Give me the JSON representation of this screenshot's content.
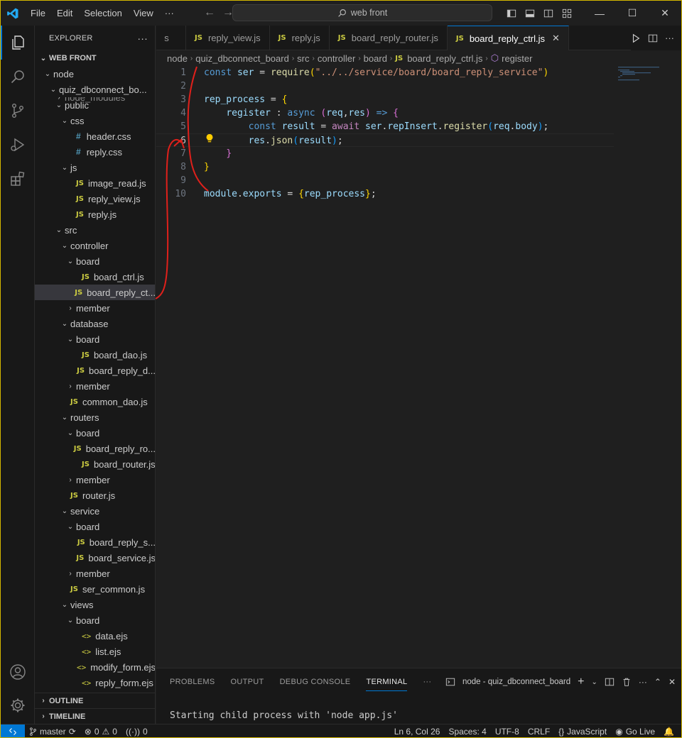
{
  "titlebar": {
    "menu": [
      "File",
      "Edit",
      "Selection",
      "View",
      "···"
    ],
    "search_text": "web front"
  },
  "sidebar": {
    "title": "EXPLORER",
    "more": "···",
    "root_label": "WEB FRONT",
    "tree": [
      {
        "label": "node",
        "chev": "⌄",
        "type": "folder"
      },
      {
        "label": "quiz_dbconnect_bo...",
        "chev": "⌄",
        "type": "folder"
      },
      {
        "label": "node_modules",
        "chev": "›",
        "type": "folder"
      },
      {
        "label": "public",
        "chev": "⌄",
        "type": "folder"
      },
      {
        "label": "css",
        "chev": "⌄",
        "type": "folder"
      },
      {
        "label": "header.css",
        "type": "css"
      },
      {
        "label": "reply.css",
        "type": "css"
      },
      {
        "label": "js",
        "chev": "⌄",
        "type": "folder"
      },
      {
        "label": "image_read.js",
        "type": "js"
      },
      {
        "label": "reply_view.js",
        "type": "js"
      },
      {
        "label": "reply.js",
        "type": "js"
      },
      {
        "label": "src",
        "chev": "⌄",
        "type": "folder"
      },
      {
        "label": "controller",
        "chev": "⌄",
        "type": "folder"
      },
      {
        "label": "board",
        "chev": "⌄",
        "type": "folder"
      },
      {
        "label": "board_ctrl.js",
        "type": "js"
      },
      {
        "label": "board_reply_ct...",
        "type": "js"
      },
      {
        "label": "member",
        "chev": "›",
        "type": "folder"
      },
      {
        "label": "database",
        "chev": "⌄",
        "type": "folder"
      },
      {
        "label": "board",
        "chev": "⌄",
        "type": "folder"
      },
      {
        "label": "board_dao.js",
        "type": "js"
      },
      {
        "label": "board_reply_d...",
        "type": "js"
      },
      {
        "label": "member",
        "chev": "›",
        "type": "folder"
      },
      {
        "label": "common_dao.js",
        "type": "js"
      },
      {
        "label": "routers",
        "chev": "⌄",
        "type": "folder"
      },
      {
        "label": "board",
        "chev": "⌄",
        "type": "folder"
      },
      {
        "label": "board_reply_ro...",
        "type": "js"
      },
      {
        "label": "board_router.js",
        "type": "js"
      },
      {
        "label": "member",
        "chev": "›",
        "type": "folder"
      },
      {
        "label": "router.js",
        "type": "js"
      },
      {
        "label": "service",
        "chev": "⌄",
        "type": "folder"
      },
      {
        "label": "board",
        "chev": "⌄",
        "type": "folder"
      },
      {
        "label": "board_reply_s...",
        "type": "js"
      },
      {
        "label": "board_service.js",
        "type": "js"
      },
      {
        "label": "member",
        "chev": "›",
        "type": "folder"
      },
      {
        "label": "ser_common.js",
        "type": "js"
      },
      {
        "label": "views",
        "chev": "⌄",
        "type": "folder"
      },
      {
        "label": "board",
        "chev": "⌄",
        "type": "folder"
      },
      {
        "label": "data.ejs",
        "type": "ejs"
      },
      {
        "label": "list.ejs",
        "type": "ejs"
      },
      {
        "label": "modify_form.ejs",
        "type": "ejs"
      },
      {
        "label": "reply_form.ejs",
        "type": "ejs"
      }
    ],
    "outline": "OUTLINE",
    "timeline": "TIMELINE",
    "js_badge": "JS",
    "css_badge": "#",
    "ejs_badge": "<>"
  },
  "tabs": [
    {
      "label": "s",
      "badge": ""
    },
    {
      "label": "reply_view.js",
      "badge": "JS"
    },
    {
      "label": "reply.js",
      "badge": "JS"
    },
    {
      "label": "board_reply_router.js",
      "badge": "JS"
    },
    {
      "label": "board_reply_ctrl.js",
      "badge": "JS",
      "active": true
    }
  ],
  "breadcrumb": [
    "node",
    "quiz_dbconnect_board",
    "src",
    "controller",
    "board",
    "board_reply_ctrl.js",
    "register"
  ],
  "editor": {
    "current_line": 6,
    "lines": [
      [
        [
          "kw",
          "const "
        ],
        [
          "var",
          "ser"
        ],
        [
          "pl",
          " = "
        ],
        [
          "fn",
          "require"
        ],
        [
          "br1",
          "("
        ],
        [
          "str",
          "\"../../service/board/board_reply_service\""
        ],
        [
          "br1",
          ")"
        ]
      ],
      [],
      [
        [
          "var",
          "rep_process"
        ],
        [
          "pl",
          " = "
        ],
        [
          "br1",
          "{"
        ]
      ],
      [
        [
          "pl",
          "    "
        ],
        [
          "var",
          "register"
        ],
        [
          "pl",
          " : "
        ],
        [
          "kw",
          "async "
        ],
        [
          "br2",
          "("
        ],
        [
          "var",
          "req"
        ],
        [
          "pl",
          ","
        ],
        [
          "var",
          "res"
        ],
        [
          "br2",
          ")"
        ],
        [
          "pl",
          " "
        ],
        [
          "kw",
          "=>"
        ],
        [
          "pl",
          " "
        ],
        [
          "br2",
          "{"
        ]
      ],
      [
        [
          "pl",
          "        "
        ],
        [
          "kw",
          "const "
        ],
        [
          "var",
          "result"
        ],
        [
          "pl",
          " = "
        ],
        [
          "ctl",
          "await "
        ],
        [
          "var",
          "ser"
        ],
        [
          "pl",
          "."
        ],
        [
          "var",
          "repInsert"
        ],
        [
          "pl",
          "."
        ],
        [
          "fn",
          "register"
        ],
        [
          "br3",
          "("
        ],
        [
          "var",
          "req"
        ],
        [
          "pl",
          "."
        ],
        [
          "var",
          "body"
        ],
        [
          "br3",
          ")"
        ],
        [
          "pl",
          ";"
        ]
      ],
      [
        [
          "pl",
          "        "
        ],
        [
          "var",
          "res"
        ],
        [
          "pl",
          "."
        ],
        [
          "fn",
          "json"
        ],
        [
          "br3",
          "("
        ],
        [
          "var",
          "result"
        ],
        [
          "br3",
          ")"
        ],
        [
          "pl",
          ";"
        ]
      ],
      [
        [
          "pl",
          "    "
        ],
        [
          "br2",
          "}"
        ]
      ],
      [
        [
          "br1",
          "}"
        ]
      ],
      [],
      [
        [
          "var",
          "module"
        ],
        [
          "pl",
          "."
        ],
        [
          "var",
          "exports"
        ],
        [
          "pl",
          " = "
        ],
        [
          "br1",
          "{"
        ],
        [
          "var",
          "rep_process"
        ],
        [
          "br1",
          "}"
        ],
        [
          "pl",
          ";"
        ]
      ]
    ]
  },
  "panel": {
    "tabs": [
      "PROBLEMS",
      "OUTPUT",
      "DEBUG CONSOLE",
      "TERMINAL"
    ],
    "active_tab": "TERMINAL",
    "more": "···",
    "terminal_name": "node - quiz_dbconnect_board",
    "terminal_output": "Starting child process with 'node app.js'"
  },
  "statusbar": {
    "branch": "master",
    "errors": "0",
    "warnings": "0",
    "ports": "0",
    "position": "Ln 6, Col 26",
    "spaces": "Spaces: 4",
    "encoding": "UTF-8",
    "eol": "CRLF",
    "language": "JavaScript",
    "golive": "Go Live"
  },
  "colors": {
    "accent": "#0078d4",
    "js_badge": "#cbcb41",
    "annotation": "#e0201b",
    "window_border": "#d4b700"
  }
}
